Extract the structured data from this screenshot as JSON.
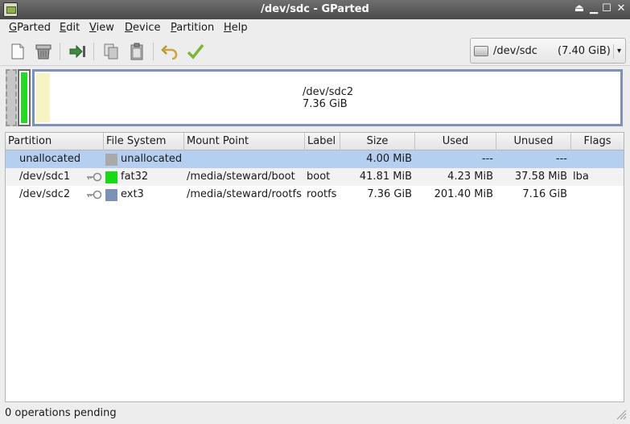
{
  "window": {
    "title": "/dev/sdc - GParted",
    "controls": {
      "shade": "⏏",
      "minimize": "▁",
      "maximize": "☐",
      "close": "✕"
    }
  },
  "menu": {
    "items": [
      "GParted",
      "Edit",
      "View",
      "Device",
      "Partition",
      "Help"
    ],
    "mnemonics": [
      "G",
      "E",
      "V",
      "D",
      "P",
      "H"
    ]
  },
  "toolbar": {
    "buttons": [
      "new-icon",
      "delete-icon",
      "resize-move-icon",
      "copy-icon",
      "paste-icon",
      "undo-icon",
      "apply-icon"
    ]
  },
  "device": {
    "name": "/dev/sdc",
    "size": "(7.40 GiB)",
    "arrow": "▾"
  },
  "graph": {
    "label_name": "/dev/sdc2",
    "label_size": "7.36 GiB",
    "colors": {
      "unallocated": "#a9a9a9",
      "fat32": "#18d918",
      "ext3": "#7b91b5",
      "used": "#f6f4c2"
    }
  },
  "table": {
    "columns": [
      "Partition",
      "File System",
      "Mount Point",
      "Label",
      "Size",
      "Used",
      "Unused",
      "Flags"
    ],
    "rows": [
      {
        "partition": "unallocated",
        "filesystem": "unallocated",
        "fs_color": "#a9a9a9",
        "mount": "",
        "label": "",
        "size": "4.00 MiB",
        "used": "---",
        "unused": "---",
        "flags": "",
        "mounted": false
      },
      {
        "partition": "/dev/sdc1",
        "filesystem": "fat32",
        "fs_color": "#18d918",
        "mount": "/media/steward/boot",
        "label": "boot",
        "size": "41.81 MiB",
        "used": "4.23 MiB",
        "unused": "37.58 MiB",
        "flags": "lba",
        "mounted": true
      },
      {
        "partition": "/dev/sdc2",
        "filesystem": "ext3",
        "fs_color": "#7b91b5",
        "mount": "/media/steward/rootfs",
        "label": "rootfs",
        "size": "7.36 GiB",
        "used": "201.40 MiB",
        "unused": "7.16 GiB",
        "flags": "",
        "mounted": true
      }
    ]
  },
  "status": {
    "text": "0 operations pending"
  }
}
